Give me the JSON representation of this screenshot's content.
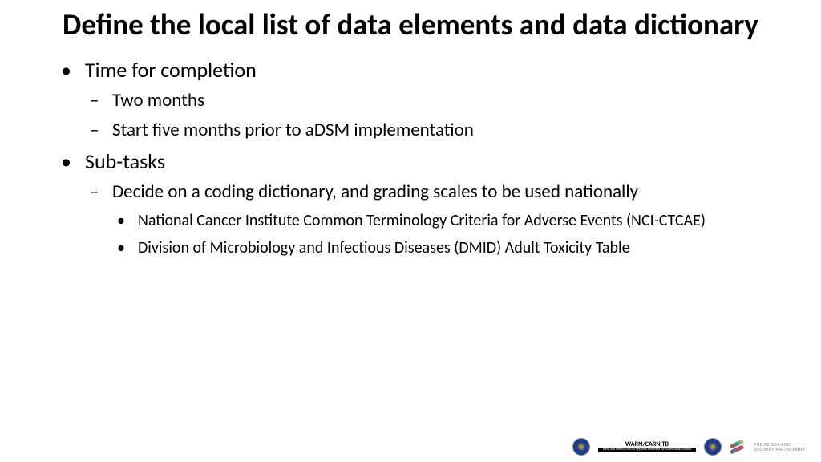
{
  "title": "Define the local list of data elements and data dictionary",
  "bullets": {
    "item1": {
      "label": "Time for completion",
      "sub1": "Two months",
      "sub2": "Start five months prior to aDSM implementation"
    },
    "item2": {
      "label": "Sub-tasks",
      "sub1": {
        "label": "Decide on a coding dictionary, and grading scales to be used nationally",
        "detail1": "National Cancer Institute Common Terminology Criteria for Adverse Events (NCI-CTCAE)",
        "detail2": "Division of Microbiology and Infectious Diseases (DMID) Adult Toxicity Table"
      }
    }
  },
  "footer": {
    "warn_title": "WARN/CARN-TB",
    "warn_sub": "West and Central African Regional Networks for Tuberculosis control",
    "adp_line1": "THE ACCESS AND",
    "adp_line2": "DELIVERY PARTNERSHIP"
  }
}
